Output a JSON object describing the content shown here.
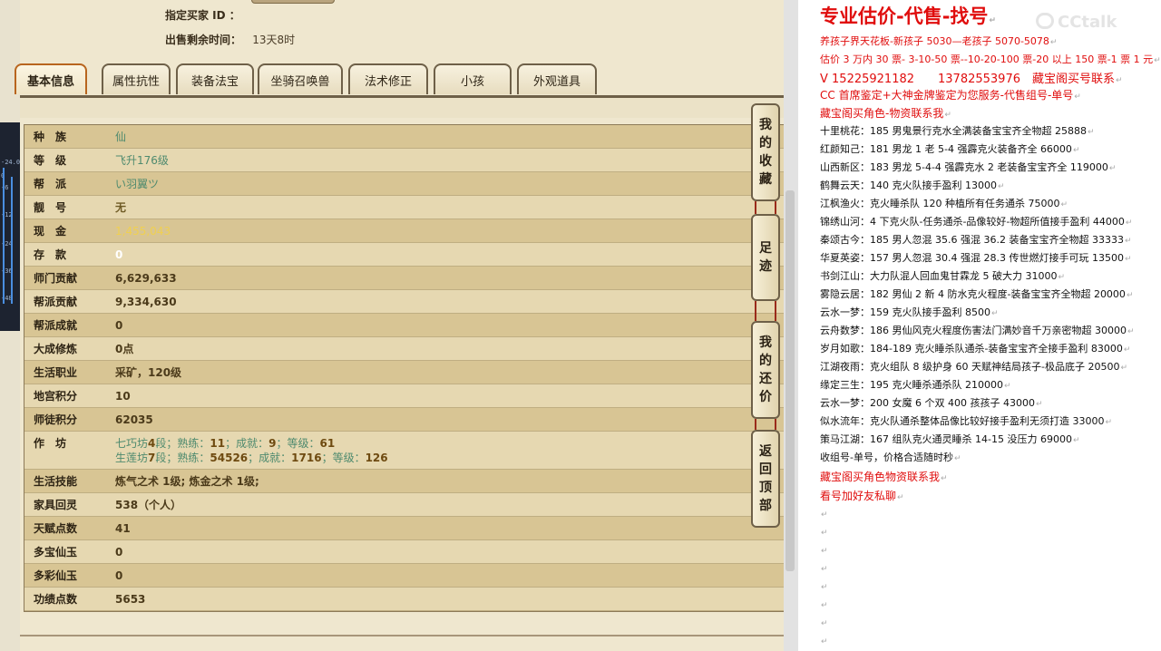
{
  "header": {
    "buyer_label": "指定买家 ID ：",
    "buyer_value": "",
    "time_label": "出售剩余时间：",
    "time_value": "13天8时"
  },
  "tabs": [
    "基本信息",
    "属性抗性",
    "装备法宝",
    "坐骑召唤兽",
    "法术修正",
    "小孩",
    "外观道具"
  ],
  "active_tab": "基本信息",
  "rows": [
    {
      "key": "种　族",
      "value": "仙"
    },
    {
      "key": "等　级",
      "value": "飞升176级"
    },
    {
      "key": "帮　派",
      "value": "い羽翼ツ"
    },
    {
      "key": "靓　号",
      "value": "无"
    },
    {
      "key": "现　金",
      "value": "1,455,043"
    },
    {
      "key": "存　款",
      "value": "0"
    },
    {
      "key": "师门贡献",
      "value": "6,629,633"
    },
    {
      "key": "帮派贡献",
      "value": "9,334,630"
    },
    {
      "key": "帮派成就",
      "value": "0"
    },
    {
      "key": "大成修炼",
      "value": "0点"
    },
    {
      "key": "生活职业",
      "value": "采矿，120级"
    },
    {
      "key": "地宫积分",
      "value": "10"
    },
    {
      "key": "师徒积分",
      "value": "62035"
    },
    {
      "key": "作　坊",
      "line1_a": "七巧坊",
      "line1_b": "4",
      "line1_c": "段；熟练：",
      "line1_d": "11",
      "line1_e": "；成就：",
      "line1_f": "9",
      "line1_g": "；等级：",
      "line1_h": "61",
      "line2_a": "生莲坊",
      "line2_b": "7",
      "line2_c": "段；熟练：",
      "line2_d": "54526",
      "line2_e": "；成就：",
      "line2_f": "1716",
      "line2_g": "；等级：",
      "line2_h": "126"
    },
    {
      "key": "生活技能",
      "value": "炼气之术 1级; 炼金之术 1级;"
    },
    {
      "key": "家具回灵",
      "value": "538（个人）"
    },
    {
      "key": "天赋点数",
      "value": "41"
    },
    {
      "key": "多宝仙玉",
      "value": "0"
    },
    {
      "key": "多彩仙玉",
      "value": "0"
    },
    {
      "key": "功绩点数",
      "value": "5653"
    }
  ],
  "side_buttons": [
    "我的收藏",
    "足迹",
    "我的还价",
    "返回顶部"
  ],
  "mixer_labels": [
    "-24.0",
    "0",
    "-6",
    "-12",
    "-24",
    "-36",
    "-48"
  ],
  "doc": {
    "title": "专业估价-代售-找号",
    "lines": [
      {
        "text": "养孩子界天花板-新孩子 5030—老孩子 5070-5078",
        "color": "red"
      },
      {
        "text": "估价 3 万内 30 票- 3-10-50 票--10-20-100 票-20 以上 150 票-1 票 1 元",
        "color": "red"
      },
      {
        "text": "V 15225921182　　13782553976　藏宝阁买号联系",
        "color": "red"
      },
      {
        "text": "CC 首席鉴定+大神金牌鉴定为您服务-代售组号-单号",
        "color": "red"
      },
      {
        "text": "藏宝阁买角色-物资联系我",
        "color": "red"
      },
      {
        "text": "十里桃花：185 男鬼景行克水全满装备宝宝齐全物超 25888",
        "color": "black"
      },
      {
        "text": "红颜知己：181 男龙 1 老 5-4 强霹克火装备齐全 66000",
        "color": "black"
      },
      {
        "text": "山西新区：183 男龙 5-4-4 强霹克水 2 老装备宝宝齐全 119000",
        "color": "black"
      },
      {
        "text": "鹤舞云天：140 克火队接手盈利 13000",
        "color": "black"
      },
      {
        "text": "江枫渔火：克火睡杀队 120 种植所有任务通杀 75000",
        "color": "black"
      },
      {
        "text": "锦绣山河：4 下克火队-任务通杀-品像较好-物超所值接手盈利 44000",
        "color": "black"
      },
      {
        "text": "秦颂古今：185 男人忽混 35.6 强混 36.2 装备宝宝齐全物超 33333",
        "color": "black"
      },
      {
        "text": "华夏英姿：157 男人忽混 30.4 强混 28.3 传世燃灯接手可玩 13500",
        "color": "black"
      },
      {
        "text": "书剑江山：大力队混人回血鬼甘霖龙 5 破大力 31000",
        "color": "black"
      },
      {
        "text": "雾隐云居：182 男仙 2 新 4 防水克火程度-装备宝宝齐全物超 20000",
        "color": "black"
      },
      {
        "text": "云水一梦：159 克火队接手盈利 8500",
        "color": "black"
      },
      {
        "text": "云舟数梦：186 男仙风克火程度伤害法门满妙音千万亲密物超 30000",
        "color": "black"
      },
      {
        "text": "岁月如歌：184-189 克火睡杀队通杀-装备宝宝齐全接手盈利 83000",
        "color": "black"
      },
      {
        "text": "江湖夜雨：克火组队 8 级护身 60 天赋神结局孩子-极品底子 20500",
        "color": "black"
      },
      {
        "text": "缘定三生：195 克火睡杀通杀队 210000",
        "color": "black"
      },
      {
        "text": "云水一梦：200 女魔 6 个双 400 孩孩子 43000",
        "color": "black"
      },
      {
        "text": "似水流年：克火队通杀整体品像比较好接手盈利无须打造 33000",
        "color": "black"
      },
      {
        "text": "策马江湖：167 组队克火通灵睡杀 14-15 没压力 69000",
        "color": "black"
      },
      {
        "text": "收组号-单号，价格合适随时秒",
        "color": "black"
      },
      {
        "text": "藏宝阁买角色物资联系我",
        "color": "red"
      },
      {
        "text": "看号加好友私聊",
        "color": "red"
      }
    ],
    "empty_marks": 8,
    "watermark": "CCtalk"
  },
  "colors": {
    "doc_red": "#e00d0d",
    "tab_active_border": "#b8651e"
  }
}
